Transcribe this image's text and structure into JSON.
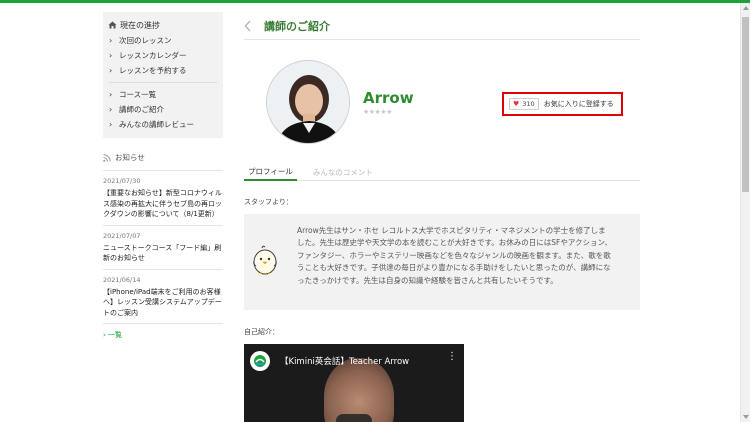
{
  "sidebar": {
    "progress_title": "現在の進捗",
    "menu_group1": [
      {
        "label": "次回のレッスン"
      },
      {
        "label": "レッスンカレンダー"
      },
      {
        "label": "レッスンを予約する"
      }
    ],
    "menu_group2": [
      {
        "label": "コース一覧"
      },
      {
        "label": "講師のご紹介"
      },
      {
        "label": "みんなの講師レビュー"
      }
    ],
    "news": {
      "heading": "お知らせ",
      "items": [
        {
          "date": "2021/07/30",
          "text": "【重要なお知らせ】新型コロナウィルス感染の再拡大に伴うセブ島の再ロックダウンの影響について（8/1更新）"
        },
        {
          "date": "2021/07/07",
          "text": "ニューストークコース「フード編」刷新のお知らせ"
        },
        {
          "date": "2021/06/14",
          "text": "【iPhone/iPad端末をご利用のお客様へ】レッスン受講システムアップデートのご案内"
        }
      ],
      "more_label": "一覧"
    }
  },
  "main": {
    "page_title": "講師のご紹介",
    "teacher": {
      "name": "Arrow",
      "stars": "★★★★★",
      "favorite_count": "310",
      "favorite_label": "お気に入りに登録する"
    },
    "tabs": [
      {
        "label": "プロフィール"
      },
      {
        "label": "みんなのコメント"
      }
    ],
    "staff_label": "スタッフより：",
    "staff_text": "Arrow先生はサン・ホセ レコルトス大学でホスピタリティ・マネジメントの学士を修了しました。先生は歴史学や天文学の本を読むことが大好きです。お休みの日にはSFやアクション、ファンタジー、ホラーやミステリー映画などを色々なジャンルの映画を観ます。また、歌を歌うことも大好きです。子供達の毎日がより豊かになる手助けをしたいと思ったのが、講師になったきっかけです。先生は自身の知識や経験を皆さんと共有したいそうです。",
    "intro_label": "自己紹介：",
    "video_title": "【Kimini英会話】Teacher Arrow"
  },
  "colors": {
    "accent_green": "#1aa33b",
    "title_green": "#3a7d36",
    "highlight_red": "#e00000",
    "heart": "#e4374f"
  }
}
